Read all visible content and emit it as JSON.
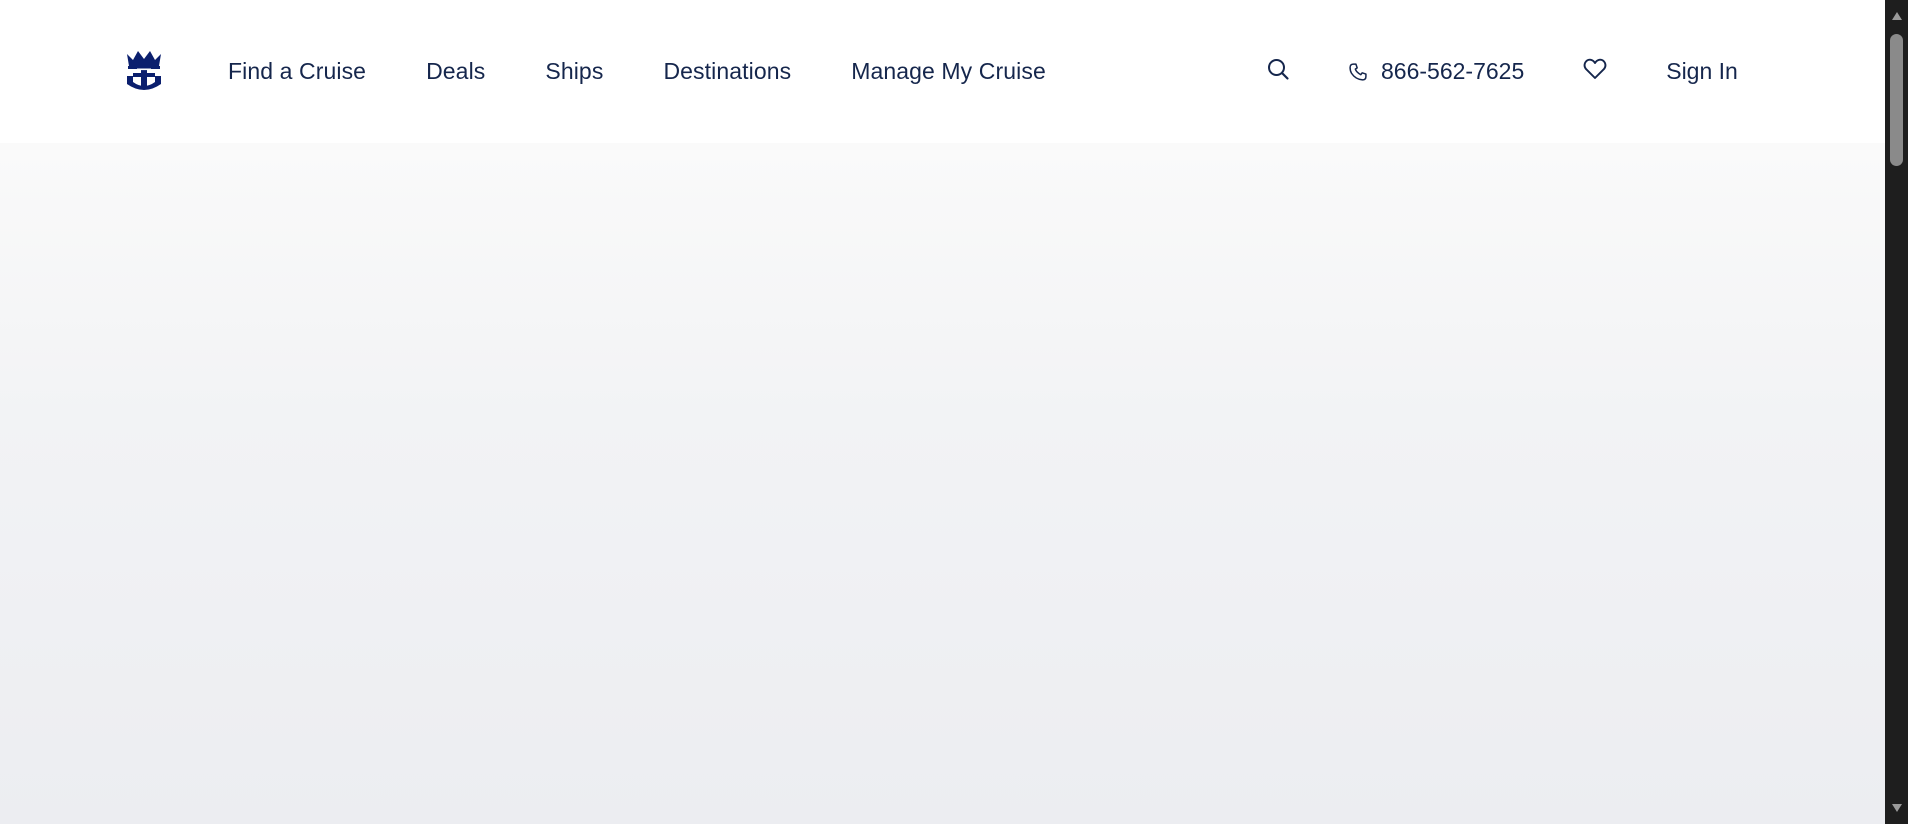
{
  "header": {
    "logo_icon": "royal-caribbean-crown-anchor-icon",
    "nav": [
      {
        "label": "Find a Cruise"
      },
      {
        "label": "Deals"
      },
      {
        "label": "Ships"
      },
      {
        "label": "Destinations"
      },
      {
        "label": "Manage My Cruise"
      }
    ],
    "search_icon": "search-icon",
    "phone_icon": "phone-icon",
    "phone_number": "866-562-7625",
    "favorites_icon": "heart-icon",
    "sign_in_label": "Sign In"
  },
  "colors": {
    "brand_navy": "#15264c",
    "logo_navy": "#0b1f6e",
    "header_bg": "#ffffff",
    "hero_gradient_top": "#fafafa",
    "hero_gradient_bottom": "#ecedf1",
    "scrollbar_track": "#1e1e1e",
    "scrollbar_thumb": "#8a8a8a"
  }
}
